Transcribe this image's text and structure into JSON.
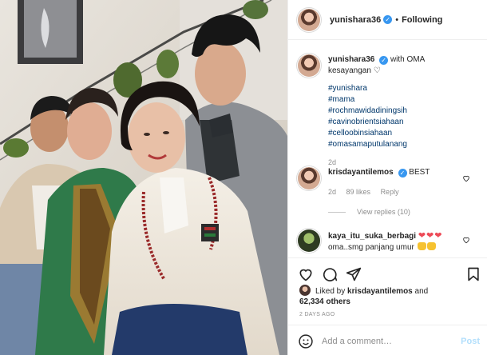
{
  "header": {
    "username": "yunishara36",
    "verified_icon": "verified-badge-icon",
    "separator": "•",
    "follow_state": "Following"
  },
  "caption": {
    "username": "yunishara36",
    "text": "with OMA kesayangan",
    "emoji": "♡",
    "hashtags": [
      "#yunishara",
      "#mama",
      "#rochmawidadiningsih",
      "#cavinobrientsiahaan",
      "#celloobinsiahaan",
      "#omasamaputulanang"
    ],
    "time": "2d"
  },
  "comments": [
    {
      "username": "krisdayantilemos",
      "verified": true,
      "text": "BEST",
      "time": "2d",
      "likes": "89 likes",
      "reply": "Reply",
      "view_replies": "View replies (10)"
    },
    {
      "username": "kaya_itu_suka_berbagi",
      "verified": false,
      "text_line1": "❤❤❤",
      "text_line2": "oma..smg panjang umur"
    }
  ],
  "actions": {
    "like_icon": "heart-icon",
    "comment_icon": "comment-icon",
    "share_icon": "paper-plane-icon",
    "save_icon": "bookmark-icon"
  },
  "likes": {
    "prefix": "Liked by",
    "liker": "krisdayantilemos",
    "connector": "and",
    "others": "62,334 others"
  },
  "timestamp": "2 DAYS AGO",
  "composer": {
    "placeholder": "Add a comment…",
    "post_label": "Post",
    "emoji_icon": "smiley-icon"
  },
  "colors": {
    "link": "#00376b",
    "verified": "#3897f0",
    "muted": "#8e8e8e",
    "post_disabled": "#b2dffc",
    "heart": "#ed4956"
  }
}
